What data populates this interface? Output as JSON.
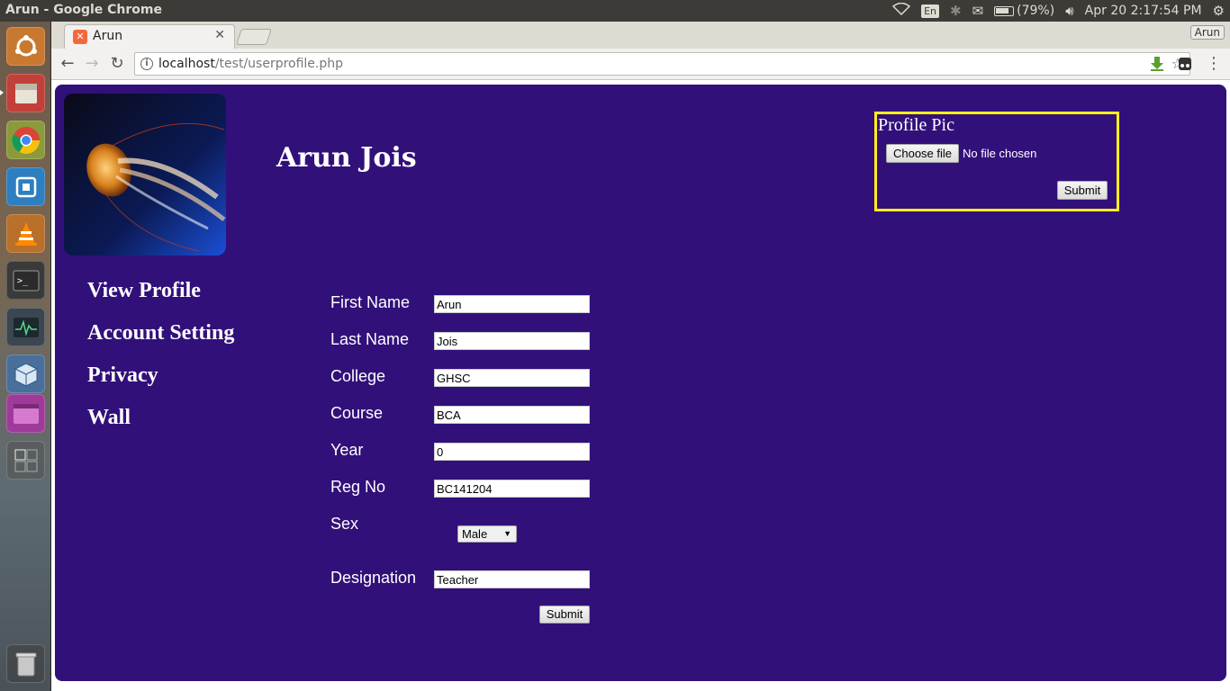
{
  "system": {
    "window_title": "Arun - Google Chrome",
    "keyboard": "En",
    "battery": "(79%)",
    "datetime": "Apr 20  2:17:54 PM"
  },
  "browser": {
    "tab_title": "Arun",
    "profile_name": "Arun",
    "url_host": "localhost",
    "url_path": "/test/userprofile.php"
  },
  "profile": {
    "name": "Arun Jois"
  },
  "sidebar": {
    "items": [
      {
        "label": "View Profile"
      },
      {
        "label": "Account Setting"
      },
      {
        "label": "Privacy"
      },
      {
        "label": "Wall"
      }
    ]
  },
  "form": {
    "first_name": {
      "label": "First Name",
      "value": "Arun"
    },
    "last_name": {
      "label": "Last Name",
      "value": "Jois"
    },
    "college": {
      "label": "College",
      "value": "GHSC"
    },
    "course": {
      "label": "Course",
      "value": "BCA"
    },
    "year": {
      "label": "Year",
      "value": "0"
    },
    "reg_no": {
      "label": "Reg No",
      "value": "BC141204"
    },
    "sex": {
      "label": "Sex",
      "value": "Male"
    },
    "designation": {
      "label": "Designation",
      "value": "Teacher"
    },
    "submit_label": "Submit"
  },
  "profile_pic": {
    "title": "Profile Pic",
    "choose_label": "Choose file",
    "no_file": "No file chosen",
    "submit_label": "Submit"
  },
  "colors": {
    "page_bg": "#32107a",
    "picbox_border": "#ffef1a"
  }
}
